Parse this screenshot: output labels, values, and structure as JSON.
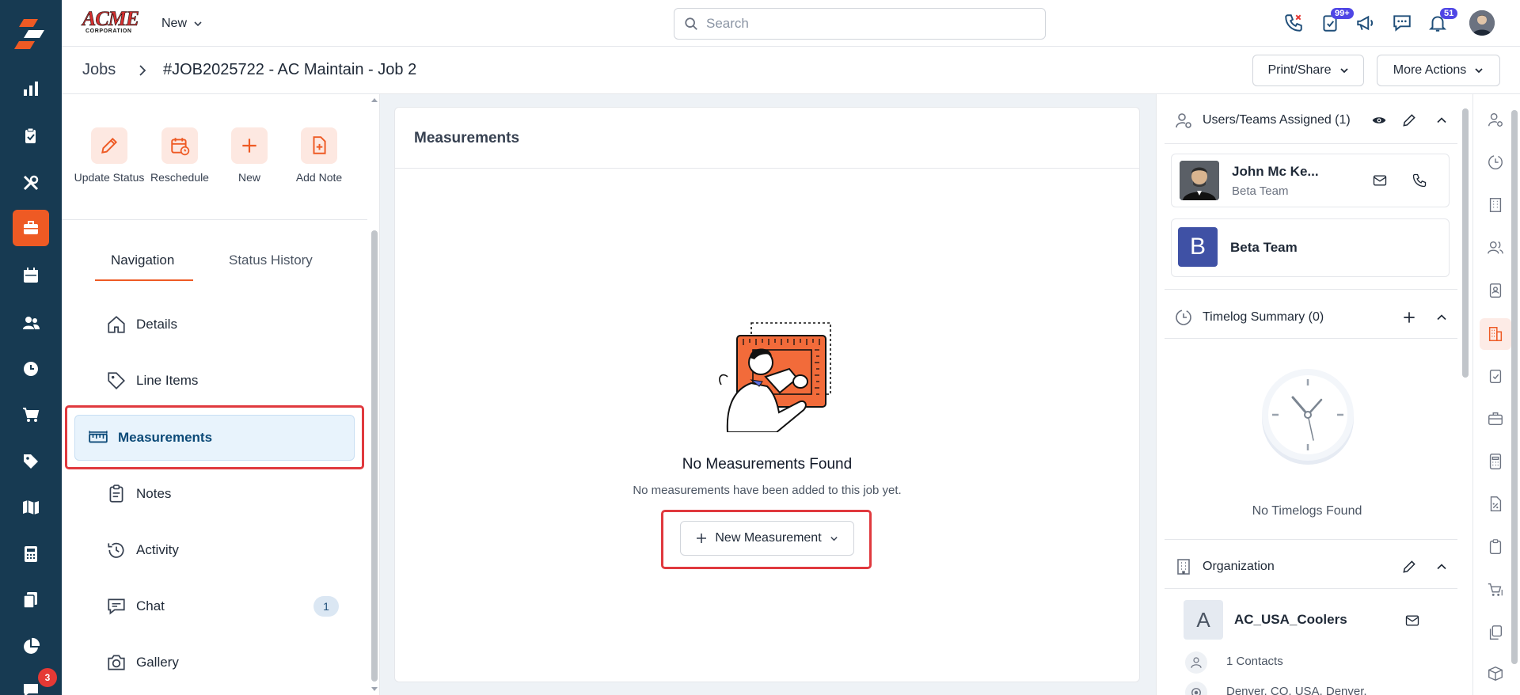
{
  "brand": {
    "name": "ACME",
    "sub": "CORPORATION",
    "accent": "#ee5a24",
    "rail_bg": "#173a52"
  },
  "topbar": {
    "new_label": "New",
    "search_placeholder": "Search",
    "tasks_badge": "99+",
    "notif_badge": "51"
  },
  "rail": {
    "icons": [
      "logo-icon",
      "chart-icon",
      "clipboard-icon",
      "tools-icon",
      "briefcase-icon",
      "calendar-icon",
      "users-icon",
      "clock-icon",
      "cart-icon",
      "tag-icon",
      "map-icon",
      "calculator-icon",
      "documents-icon",
      "pie-chart-icon",
      "chat-icon"
    ],
    "chat_badge": "3"
  },
  "breadcrumb": {
    "root": "Jobs",
    "title": "#JOB2025722 - AC Maintain - Job 2",
    "print_share": "Print/Share",
    "more_actions": "More Actions"
  },
  "quick_actions": [
    {
      "label": "Update Status",
      "icon": "pencil-icon"
    },
    {
      "label": "Reschedule",
      "icon": "calendar-clock-icon"
    },
    {
      "label": "New",
      "icon": "plus-icon"
    },
    {
      "label": "Add Note",
      "icon": "note-plus-icon"
    }
  ],
  "tabs": {
    "navigation": "Navigation",
    "status_history": "Status History"
  },
  "nav": {
    "items": [
      {
        "label": "Details",
        "icon": "home-icon"
      },
      {
        "label": "Line Items",
        "icon": "tag-icon"
      },
      {
        "label": "Measurements",
        "icon": "ruler-icon",
        "active": true
      },
      {
        "label": "Notes",
        "icon": "clipboard-icon"
      },
      {
        "label": "Activity",
        "icon": "history-icon"
      },
      {
        "label": "Chat",
        "icon": "chat-icon",
        "count": "1"
      },
      {
        "label": "Gallery",
        "icon": "camera-icon"
      }
    ]
  },
  "main": {
    "title": "Measurements",
    "empty_title": "No Measurements Found",
    "empty_sub": "No measurements have been added to this job yet.",
    "new_button": "New Measurement"
  },
  "right": {
    "users_title": "Users/Teams Assigned (1)",
    "user_name": "John Mc Ke...",
    "user_team": "Beta Team",
    "team_initial": "B",
    "team_name": "Beta Team",
    "timelog_title": "Timelog Summary (0)",
    "no_timelogs": "No Timelogs Found",
    "org_title": "Organization",
    "org_initial": "A",
    "org_name": "AC_USA_Coolers",
    "contacts": "1 Contacts",
    "address": "Denver, CO, USA, Denver,"
  }
}
